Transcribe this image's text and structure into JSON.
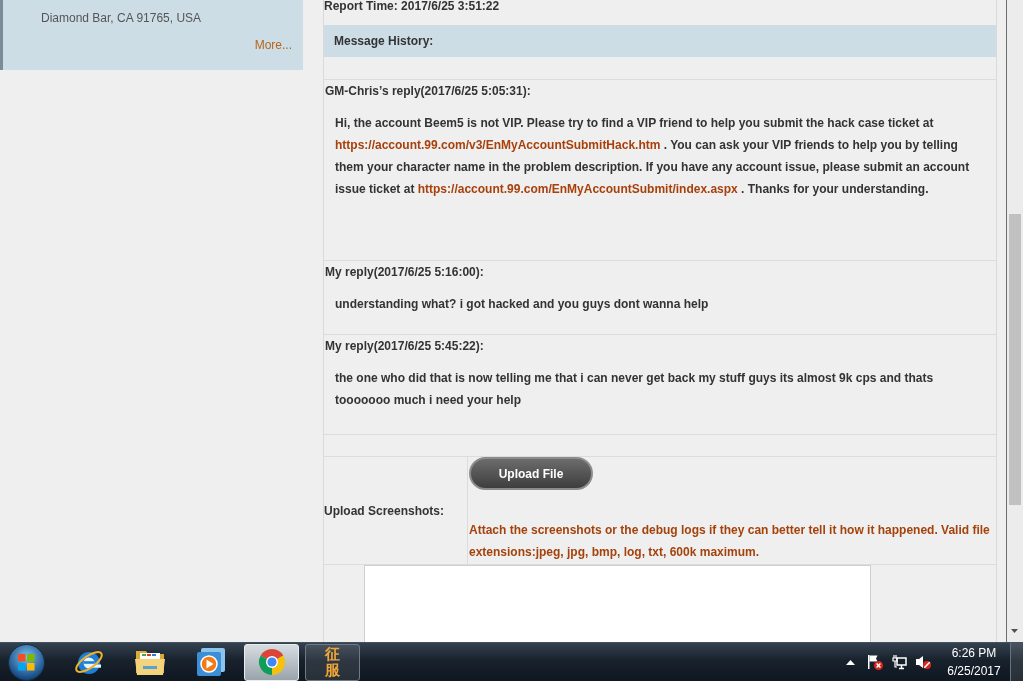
{
  "sidebar": {
    "address": "Diamond Bar, CA 91765, USA",
    "more_link": "More..."
  },
  "ticket": {
    "report_time": "Report Time: 2017/6/25 3:51:22",
    "history_title": "Message History:",
    "messages": [
      {
        "header": "GM-Chris’s reply(2017/6/25 5:05:31):",
        "body": [
          {
            "kind": "text",
            "text": "Hi, the account Beem5 is not VIP. Please try to find a VIP friend to help you submit the hack case ticket at "
          },
          {
            "kind": "link",
            "text": "https://account.99.com/v3/EnMyAccountSubmitHack.htm"
          },
          {
            "kind": "text",
            "text": " . You can ask your VIP friends to help you by telling them your character name in the problem description. If you have any account issue, please submit an account issue ticket at "
          },
          {
            "kind": "link",
            "text": "https://account.99.com/EnMyAccountSubmit/index.aspx"
          },
          {
            "kind": "text",
            "text": " . Thanks for your understanding."
          }
        ]
      },
      {
        "header": "My reply(2017/6/25 5:16:00):",
        "body": [
          {
            "kind": "text",
            "text": "understanding what? i got hacked and you guys dont wanna help"
          }
        ]
      },
      {
        "header": "My reply(2017/6/25 5:45:22):",
        "body": [
          {
            "kind": "text",
            "text": "the one who did that is now telling me that i can never get back my stuff guys its almost 9k cps and thats tooooooo much i need your help"
          }
        ]
      }
    ],
    "upload": {
      "label": "Upload Screenshots:",
      "button": "Upload File",
      "hint": "Attach the screenshots or the debug logs if they can better tell it how it happened. Valid file extensions:jpeg, jpg, bmp, log, txt, 600k maximum."
    }
  },
  "taskbar": {
    "apps": [
      {
        "kind": "internet",
        "running": false,
        "selected": false
      },
      {
        "kind": "folder",
        "running": false,
        "selected": false
      },
      {
        "kind": "player",
        "running": false,
        "selected": false
      },
      {
        "kind": "browser",
        "running": true,
        "selected": true
      },
      {
        "kind": "game",
        "label": "征服",
        "running": true,
        "selected": false
      }
    ],
    "tray": {
      "alert": true,
      "muted": true,
      "time": "6:26 PM",
      "date": "6/25/2017"
    }
  }
}
